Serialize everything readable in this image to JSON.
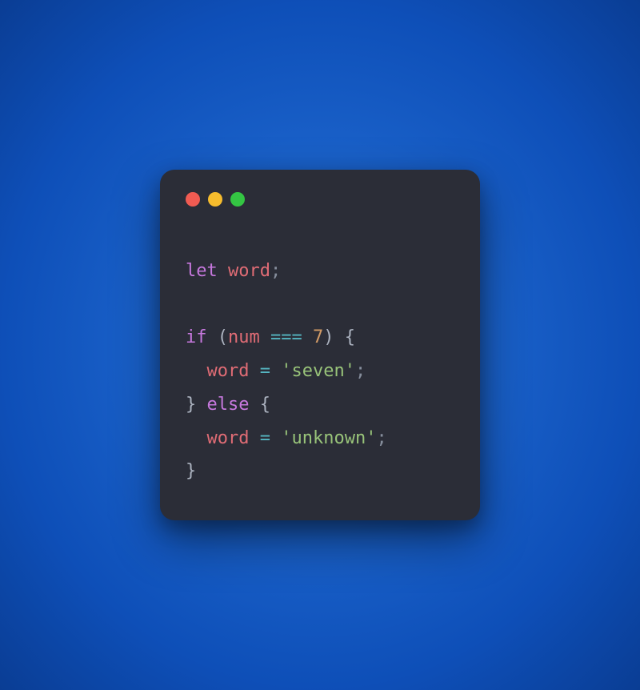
{
  "window": {
    "traffic_lights": {
      "red": "#f05b52",
      "yellow": "#f6bc2d",
      "green": "#34c543"
    }
  },
  "code": {
    "line1": {
      "keyword": "let",
      "space1": " ",
      "variable": "word",
      "semicolon": ";"
    },
    "line2": "",
    "line3": {
      "keyword": "if",
      "space1": " ",
      "lparen": "(",
      "variable": "num",
      "space2": " ",
      "operator": "===",
      "space3": " ",
      "number": "7",
      "rparen": ")",
      "space4": " ",
      "lbrace": "{"
    },
    "line4": {
      "indent": "  ",
      "variable": "word",
      "space1": " ",
      "assign": "=",
      "space2": " ",
      "string": "'seven'",
      "semicolon": ";"
    },
    "line5": {
      "rbrace": "}",
      "space1": " ",
      "keyword": "else",
      "space2": " ",
      "lbrace": "{"
    },
    "line6": {
      "indent": "  ",
      "variable": "word",
      "space1": " ",
      "assign": "=",
      "space2": " ",
      "string": "'unknown'",
      "semicolon": ";"
    },
    "line7": {
      "rbrace": "}"
    }
  }
}
